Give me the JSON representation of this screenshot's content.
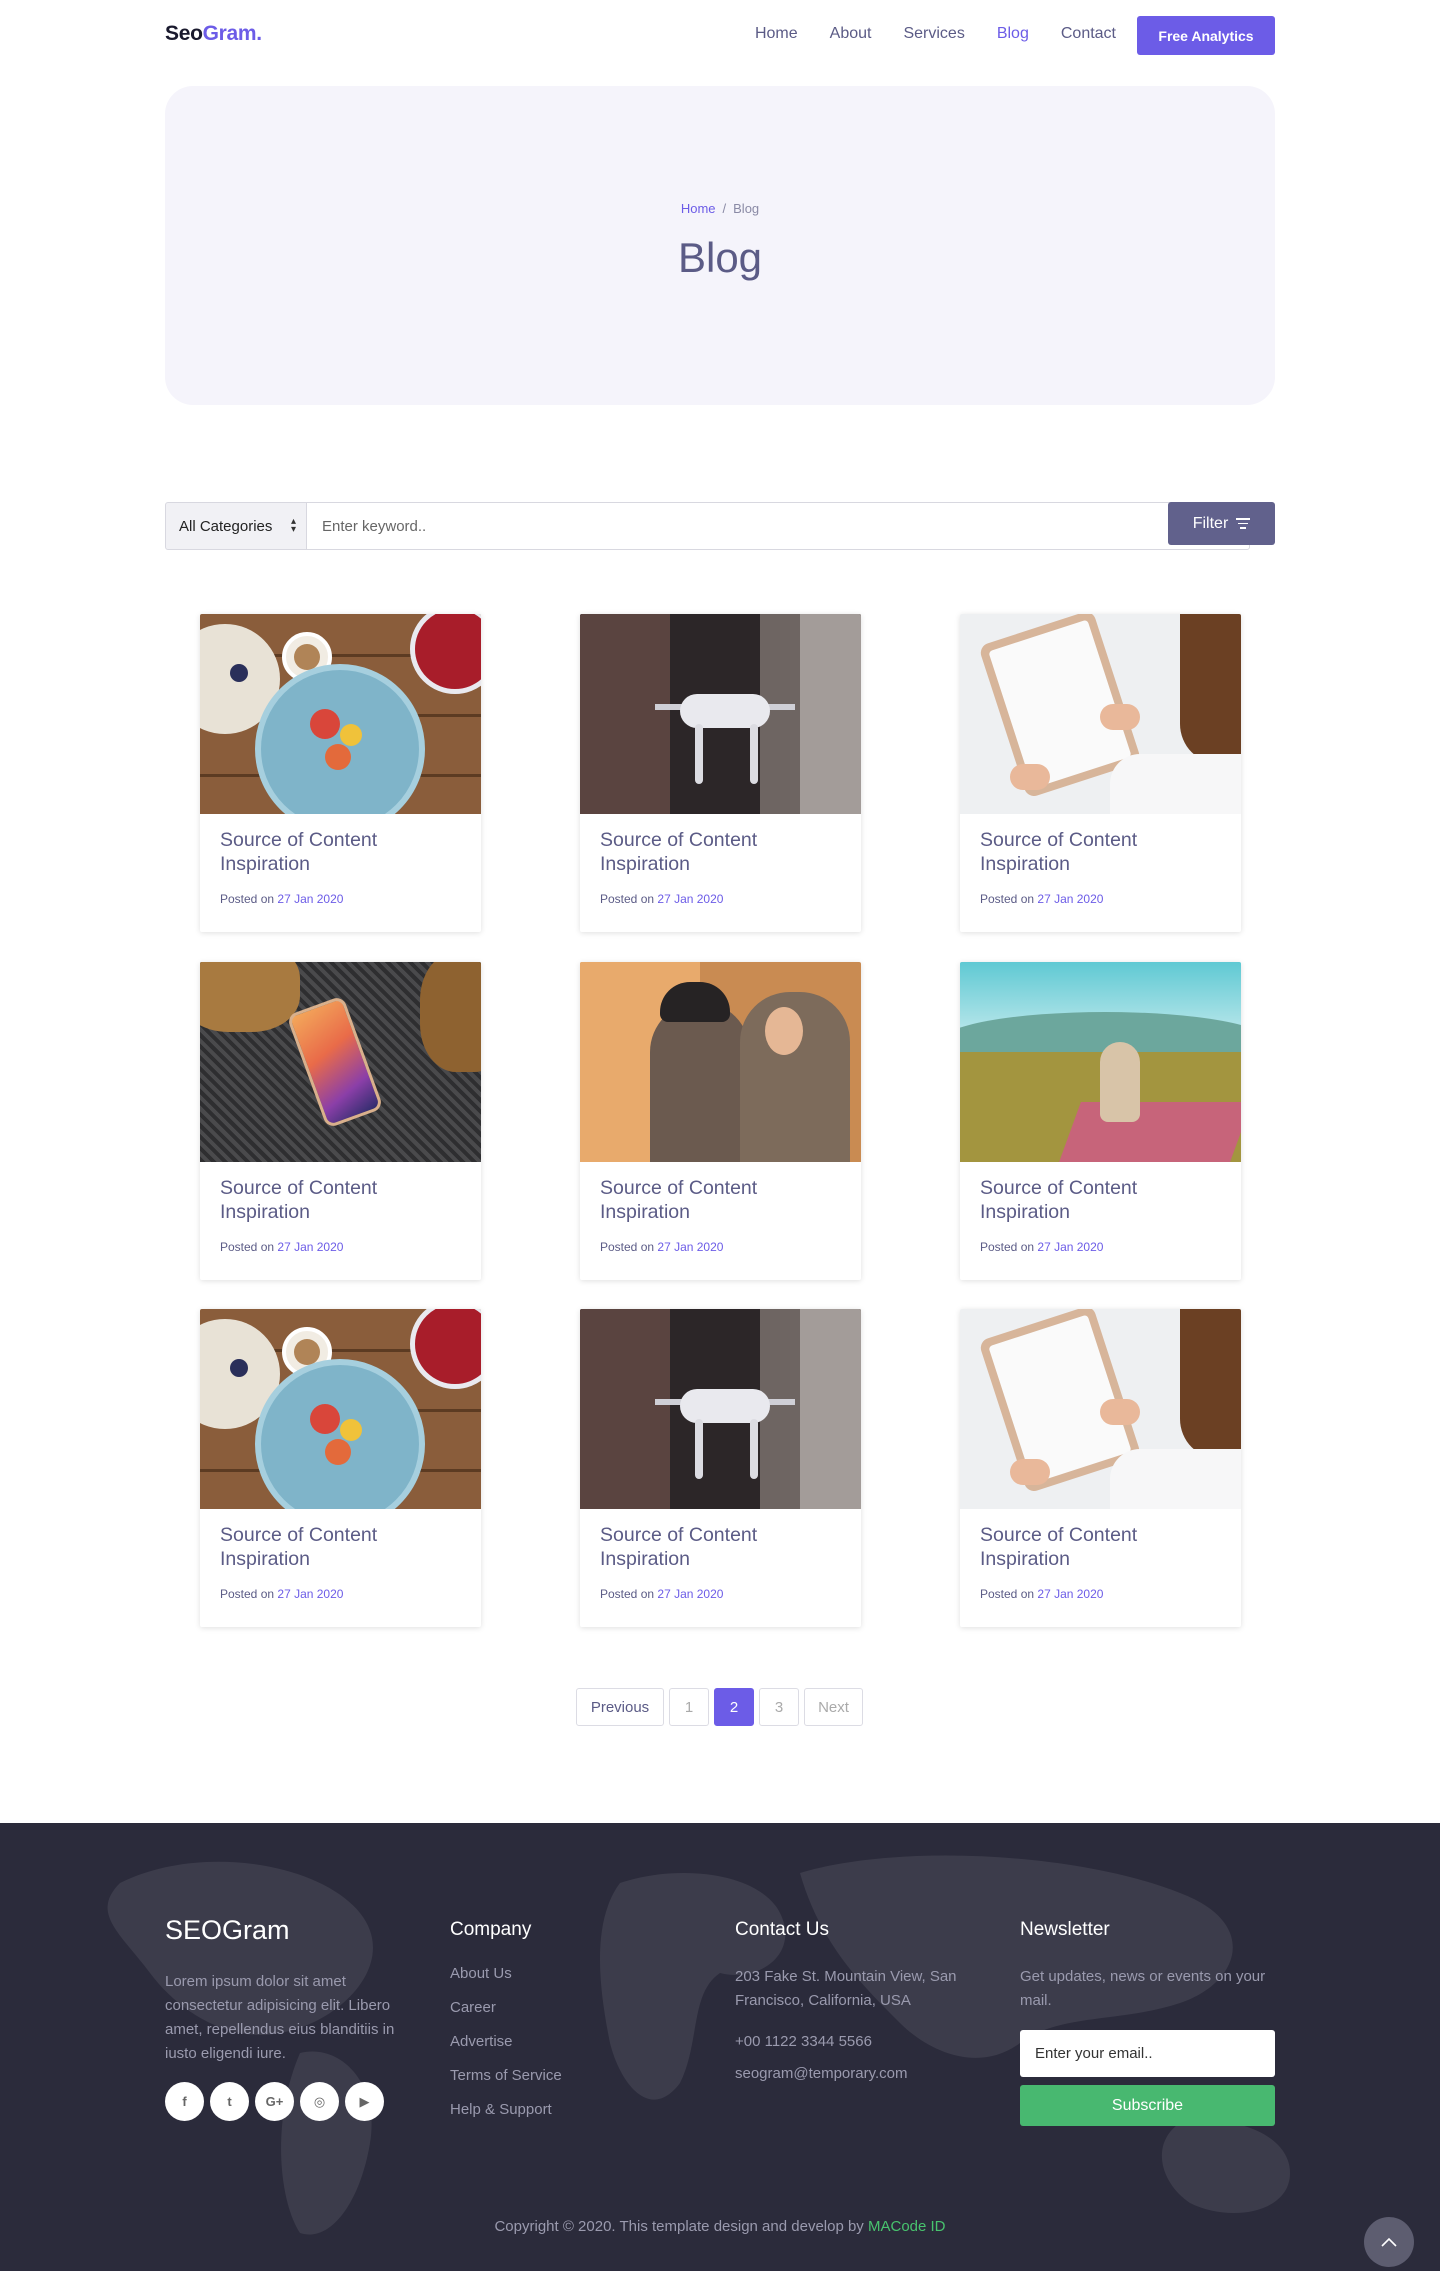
{
  "navbar": {
    "brand_part1": "Seo",
    "brand_part2": "Gram.",
    "links": [
      "Home",
      "About",
      "Services",
      "Blog",
      "Contact"
    ],
    "active_link": "Blog",
    "cta_label": "Free Analytics"
  },
  "hero": {
    "breadcrumb_home": "Home",
    "breadcrumb_sep": "/",
    "breadcrumb_current": "Blog",
    "title": "Blog"
  },
  "search": {
    "category_value": "All Categories",
    "keyword_placeholder": "Enter keyword..",
    "filter_label": "Filter"
  },
  "posts": [
    {
      "title": "Source of Content Inspiration",
      "posted_prefix": "Posted on",
      "date": "27 Jan 2020",
      "image": "food-photo"
    },
    {
      "title": "Source of Content Inspiration",
      "posted_prefix": "Posted on",
      "date": "27 Jan 2020",
      "image": "drone-photo"
    },
    {
      "title": "Source of Content Inspiration",
      "posted_prefix": "Posted on",
      "date": "27 Jan 2020",
      "image": "tablet-photo"
    },
    {
      "title": "Source of Content Inspiration",
      "posted_prefix": "Posted on",
      "date": "27 Jan 2020",
      "image": "phone-photo"
    },
    {
      "title": "Source of Content Inspiration",
      "posted_prefix": "Posted on",
      "date": "27 Jan 2020",
      "image": "people-photo"
    },
    {
      "title": "Source of Content Inspiration",
      "posted_prefix": "Posted on",
      "date": "27 Jan 2020",
      "image": "picnic-photo"
    },
    {
      "title": "Source of Content Inspiration",
      "posted_prefix": "Posted on",
      "date": "27 Jan 2020",
      "image": "food-photo"
    },
    {
      "title": "Source of Content Inspiration",
      "posted_prefix": "Posted on",
      "date": "27 Jan 2020",
      "image": "drone-photo"
    },
    {
      "title": "Source of Content Inspiration",
      "posted_prefix": "Posted on",
      "date": "27 Jan 2020",
      "image": "tablet-photo"
    }
  ],
  "pagination": {
    "previous": "Previous",
    "pages": [
      "1",
      "2",
      "3"
    ],
    "current": "2",
    "next": "Next"
  },
  "footer": {
    "brand": "SEOGram",
    "description": "Lorem ipsum dolor sit amet consectetur adipisicing elit. Libero amet, repellendus eius blanditiis in iusto eligendi iure.",
    "social_icons": [
      "facebook-icon",
      "twitter-icon",
      "google-plus-icon",
      "instagram-icon",
      "youtube-icon"
    ],
    "social_glyphs": [
      "f",
      "t",
      "G+",
      "◎",
      "▶"
    ],
    "company": {
      "heading": "Company",
      "links": [
        "About Us",
        "Career",
        "Advertise",
        "Terms of Service",
        "Help & Support"
      ]
    },
    "contact": {
      "heading": "Contact Us",
      "address": "203 Fake St. Mountain View, San Francisco, California, USA",
      "phone": "+00 1122 3344 5566",
      "email": "seogram@temporary.com"
    },
    "newsletter": {
      "heading": "Newsletter",
      "text": "Get updates, news or events on your mail.",
      "email_placeholder": "Enter your email..",
      "subscribe_label": "Subscribe"
    },
    "copyright_text": "Copyright © 2020. This template design and develop by",
    "copyright_link": "MACode ID"
  },
  "colors": {
    "accent": "#6c5ce7",
    "footer_bg": "#2b2b3b",
    "subscribe_green": "#48b870",
    "hero_bg": "#f5f4fb"
  }
}
